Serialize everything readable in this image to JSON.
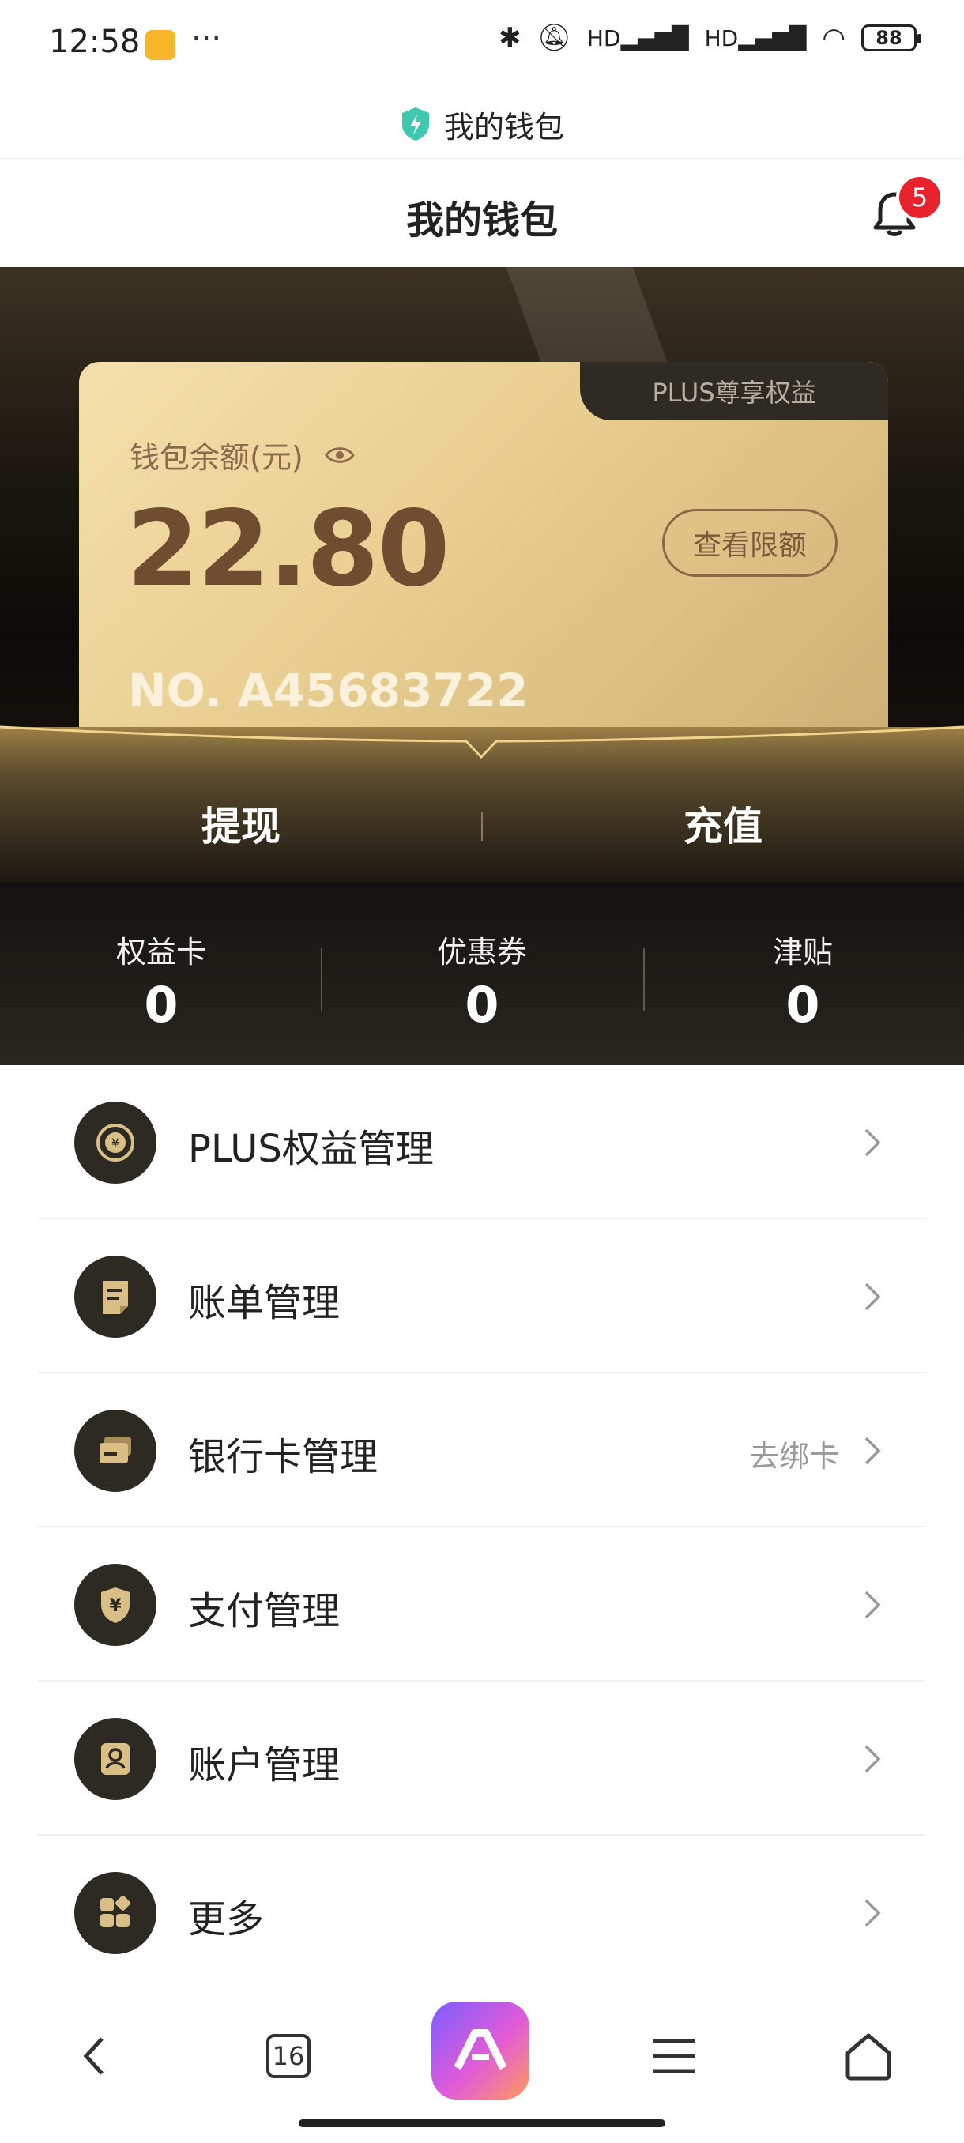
{
  "status_bar": {
    "time": "12:58",
    "battery": "88"
  },
  "url_bar": {
    "title": "我的钱包"
  },
  "header": {
    "title": "我的钱包",
    "notification_count": "5"
  },
  "wallet_card": {
    "tab_label": "PLUS尊享权益",
    "balance_label": "钱包余额(元)",
    "balance": "22.80",
    "limit_button": "查看限额",
    "card_number": "NO. A45683722"
  },
  "actions": {
    "withdraw": "提现",
    "recharge": "充值"
  },
  "stats": [
    {
      "label": "权益卡",
      "value": "0"
    },
    {
      "label": "优惠券",
      "value": "0"
    },
    {
      "label": "津贴",
      "value": "0"
    }
  ],
  "menu": [
    {
      "label": "PLUS权益管理",
      "hint": "",
      "icon": "coin-badge-icon"
    },
    {
      "label": "账单管理",
      "hint": "",
      "icon": "bill-icon"
    },
    {
      "label": "银行卡管理",
      "hint": "去绑卡",
      "icon": "bank-card-icon"
    },
    {
      "label": "支付管理",
      "hint": "",
      "icon": "yuan-shield-icon"
    },
    {
      "label": "账户管理",
      "hint": "",
      "icon": "account-icon"
    },
    {
      "label": "更多",
      "hint": "",
      "icon": "grid-more-icon"
    }
  ],
  "bottom_nav": {
    "tab_count": "16"
  },
  "colors": {
    "gold": "#e9cf92",
    "dark_gold_text": "#6e4d31",
    "badge_red": "#e8222d"
  }
}
